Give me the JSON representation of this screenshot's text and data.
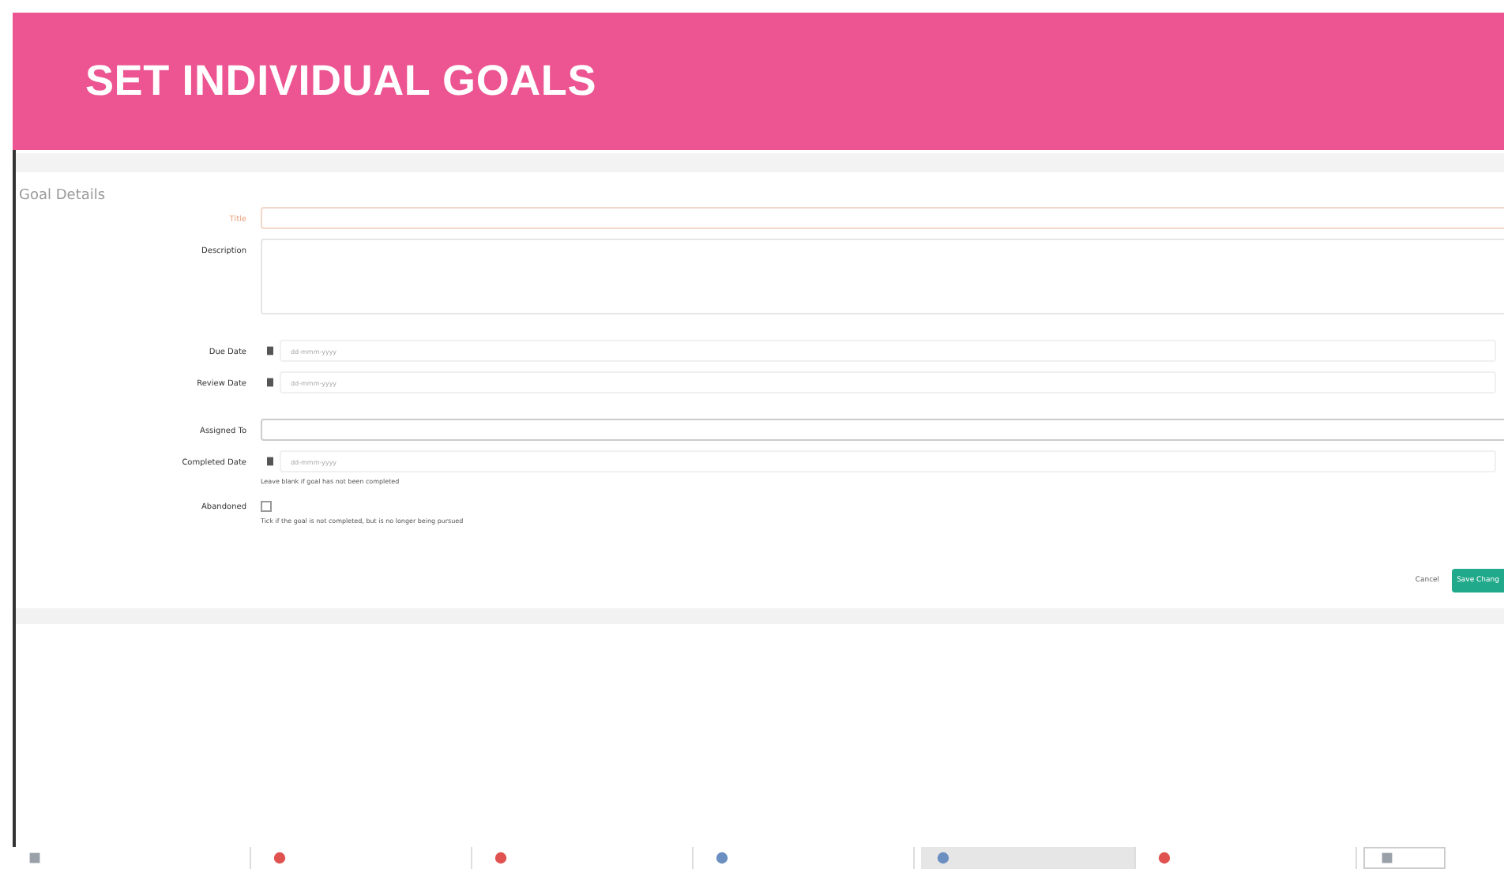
{
  "banner": {
    "title": "SET INDIVIDUAL GOALS"
  },
  "section": {
    "title": "Goal Details"
  },
  "fields": [
    {
      "kind": "text",
      "label": "Title",
      "required": true
    },
    {
      "kind": "textarea",
      "label": "Description"
    },
    {
      "kind": "date",
      "label": "Due Date",
      "placeholder": "dd-mmm-yyyy"
    },
    {
      "kind": "date",
      "label": "Review Date",
      "placeholder": "dd-mmm-yyyy"
    },
    {
      "kind": "text",
      "label": "Assigned To"
    },
    {
      "kind": "date",
      "label": "Completed Date",
      "placeholder": "dd-mmm-yyyy",
      "help": "Leave blank if goal has not been completed"
    },
    {
      "kind": "checkbox",
      "label": "Abandoned",
      "checked": false,
      "help": "Tick if the goal is not completed, but is no longer being pursued"
    }
  ],
  "buttons": {
    "cancel": "Cancel",
    "save": "Save Chang"
  },
  "taskbar": [
    {
      "kind": "square",
      "selected": false
    },
    {
      "kind": "circle",
      "color": "#e0524f",
      "selected": false
    },
    {
      "kind": "circle",
      "color": "#e0524f",
      "selected": false
    },
    {
      "kind": "circle",
      "color": "#6a8fc0",
      "selected": false
    },
    {
      "kind": "circle",
      "color": "#6a8fc0",
      "selected": true
    },
    {
      "kind": "circle",
      "color": "#e0524f",
      "selected": false
    },
    {
      "kind": "square",
      "selected": false
    }
  ]
}
